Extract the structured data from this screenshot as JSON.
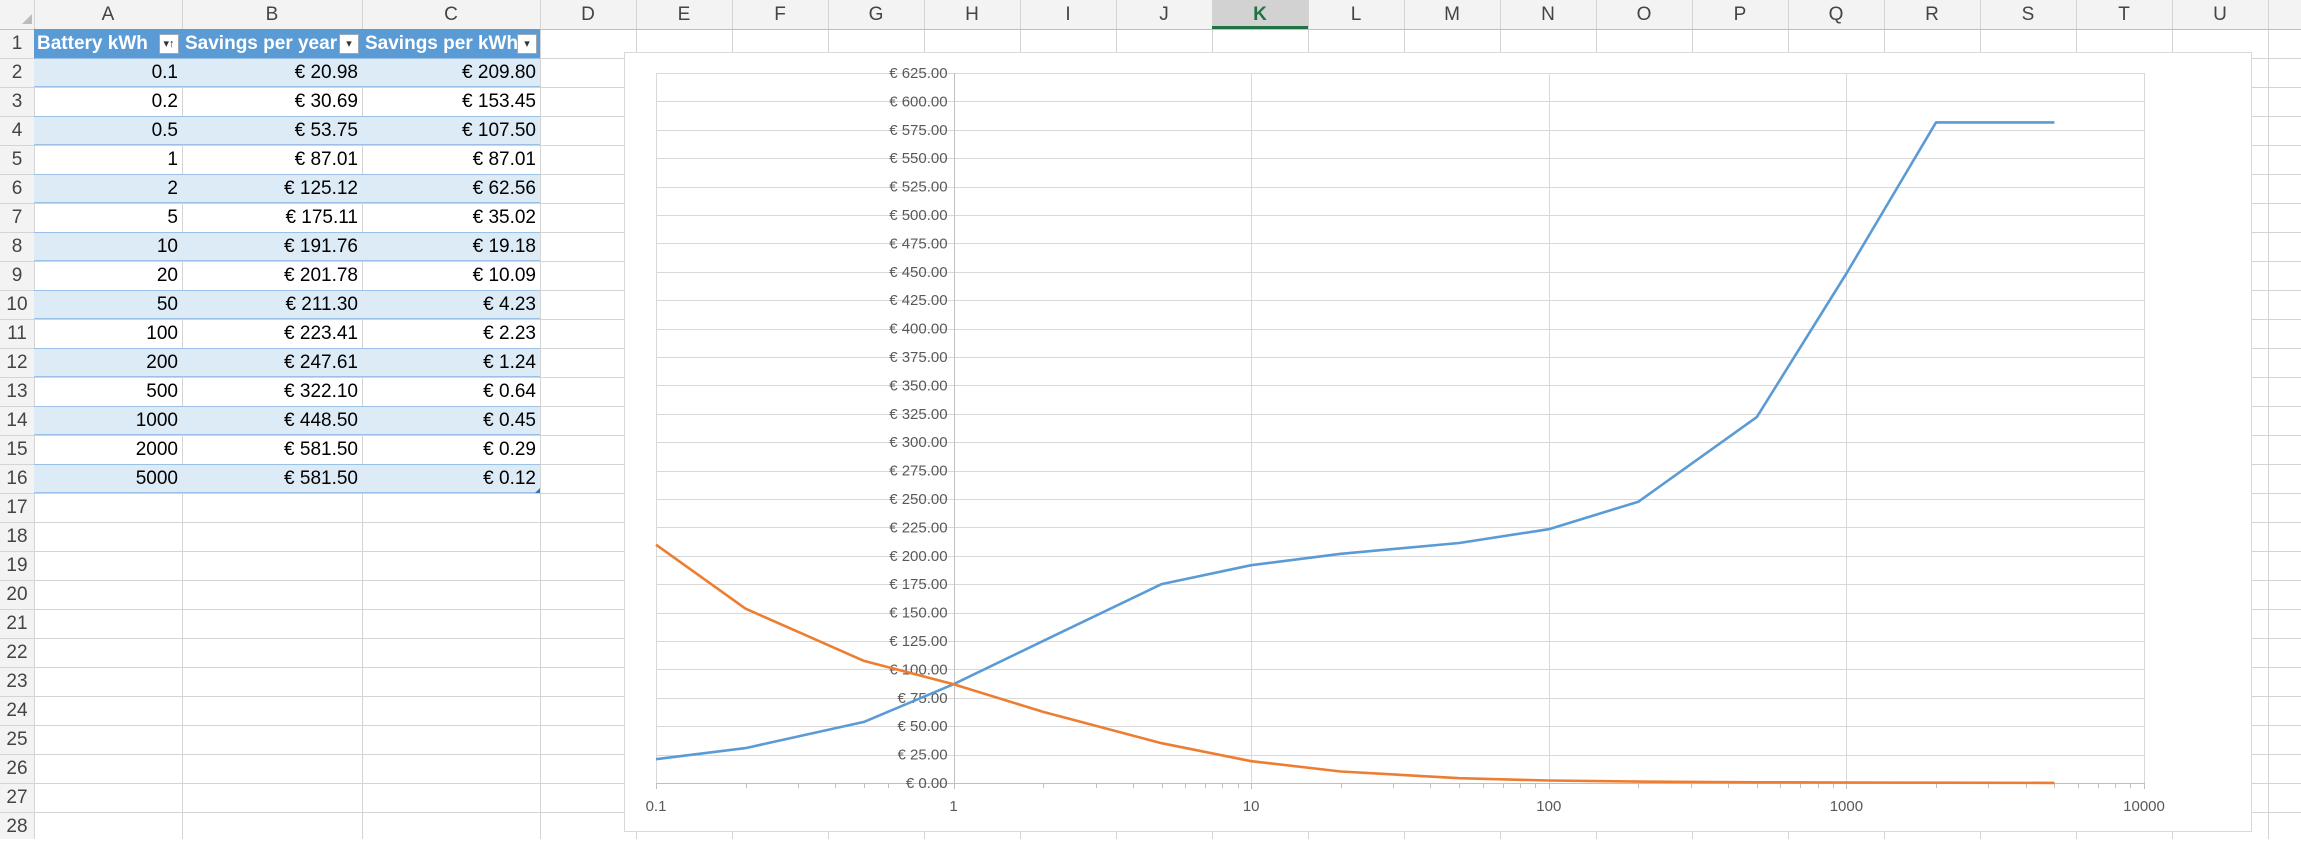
{
  "sheet": {
    "columns": [
      "A",
      "B",
      "C",
      "D",
      "E",
      "F",
      "G",
      "H",
      "I",
      "J",
      "K",
      "L",
      "M",
      "N",
      "O",
      "P",
      "Q",
      "R",
      "S",
      "T",
      "U"
    ],
    "selected_column": "K",
    "row_numbers": [
      "1",
      "2",
      "3",
      "4",
      "5",
      "6",
      "7",
      "8",
      "9",
      "10",
      "11",
      "12",
      "13",
      "14",
      "15",
      "16",
      "17",
      "18",
      "19",
      "20",
      "21",
      "22",
      "23",
      "24",
      "25",
      "26",
      "27",
      "28"
    ]
  },
  "table": {
    "headers": [
      "Battery kWh",
      "Savings per year",
      "Savings per kWh"
    ],
    "header_color": "#5b9bd5",
    "band_color": "#ddebf7",
    "rows": [
      [
        "0.1",
        "€ 20.98",
        "€ 209.80"
      ],
      [
        "0.2",
        "€ 30.69",
        "€ 153.45"
      ],
      [
        "0.5",
        "€ 53.75",
        "€ 107.50"
      ],
      [
        "1",
        "€ 87.01",
        "€ 87.01"
      ],
      [
        "2",
        "€ 125.12",
        "€ 62.56"
      ],
      [
        "5",
        "€ 175.11",
        "€ 35.02"
      ],
      [
        "10",
        "€ 191.76",
        "€ 19.18"
      ],
      [
        "20",
        "€ 201.78",
        "€ 10.09"
      ],
      [
        "50",
        "€ 211.30",
        "€ 4.23"
      ],
      [
        "100",
        "€ 223.41",
        "€ 2.23"
      ],
      [
        "200",
        "€ 247.61",
        "€ 1.24"
      ],
      [
        "500",
        "€ 322.10",
        "€ 0.64"
      ],
      [
        "1000",
        "€ 448.50",
        "€ 0.45"
      ],
      [
        "2000",
        "€ 581.50",
        "€ 0.29"
      ],
      [
        "5000",
        "€ 581.50",
        "€ 0.12"
      ]
    ]
  },
  "chart_data": {
    "type": "line",
    "x_scale": "log",
    "x": [
      0.1,
      0.2,
      0.5,
      1,
      2,
      5,
      10,
      20,
      50,
      100,
      200,
      500,
      1000,
      2000,
      5000
    ],
    "xlim": [
      0.1,
      10000
    ],
    "x_tick_labels": [
      "0.1",
      "1",
      "10",
      "100",
      "1000",
      "10000"
    ],
    "ylim": [
      0,
      625
    ],
    "y_tick_step": 25,
    "y_tick_labels": [
      "€ 0.00",
      "€ 25.00",
      "€ 50.00",
      "€ 75.00",
      "€ 100.00",
      "€ 125.00",
      "€ 150.00",
      "€ 175.00",
      "€ 200.00",
      "€ 225.00",
      "€ 250.00",
      "€ 275.00",
      "€ 300.00",
      "€ 325.00",
      "€ 350.00",
      "€ 375.00",
      "€ 400.00",
      "€ 425.00",
      "€ 450.00",
      "€ 475.00",
      "€ 500.00",
      "€ 525.00",
      "€ 550.00",
      "€ 575.00",
      "€ 600.00",
      "€ 625.00"
    ],
    "grid": true,
    "series": [
      {
        "color": "#5b9bd5",
        "values": [
          20.98,
          30.69,
          53.75,
          87.01,
          125.12,
          175.11,
          191.76,
          201.78,
          211.3,
          223.41,
          247.61,
          322.1,
          448.5,
          581.5,
          581.5
        ]
      },
      {
        "color": "#ed7d31",
        "values": [
          209.8,
          153.45,
          107.5,
          87.01,
          62.56,
          35.02,
          19.18,
          10.09,
          4.23,
          2.23,
          1.24,
          0.64,
          0.45,
          0.29,
          0.12
        ]
      }
    ]
  }
}
